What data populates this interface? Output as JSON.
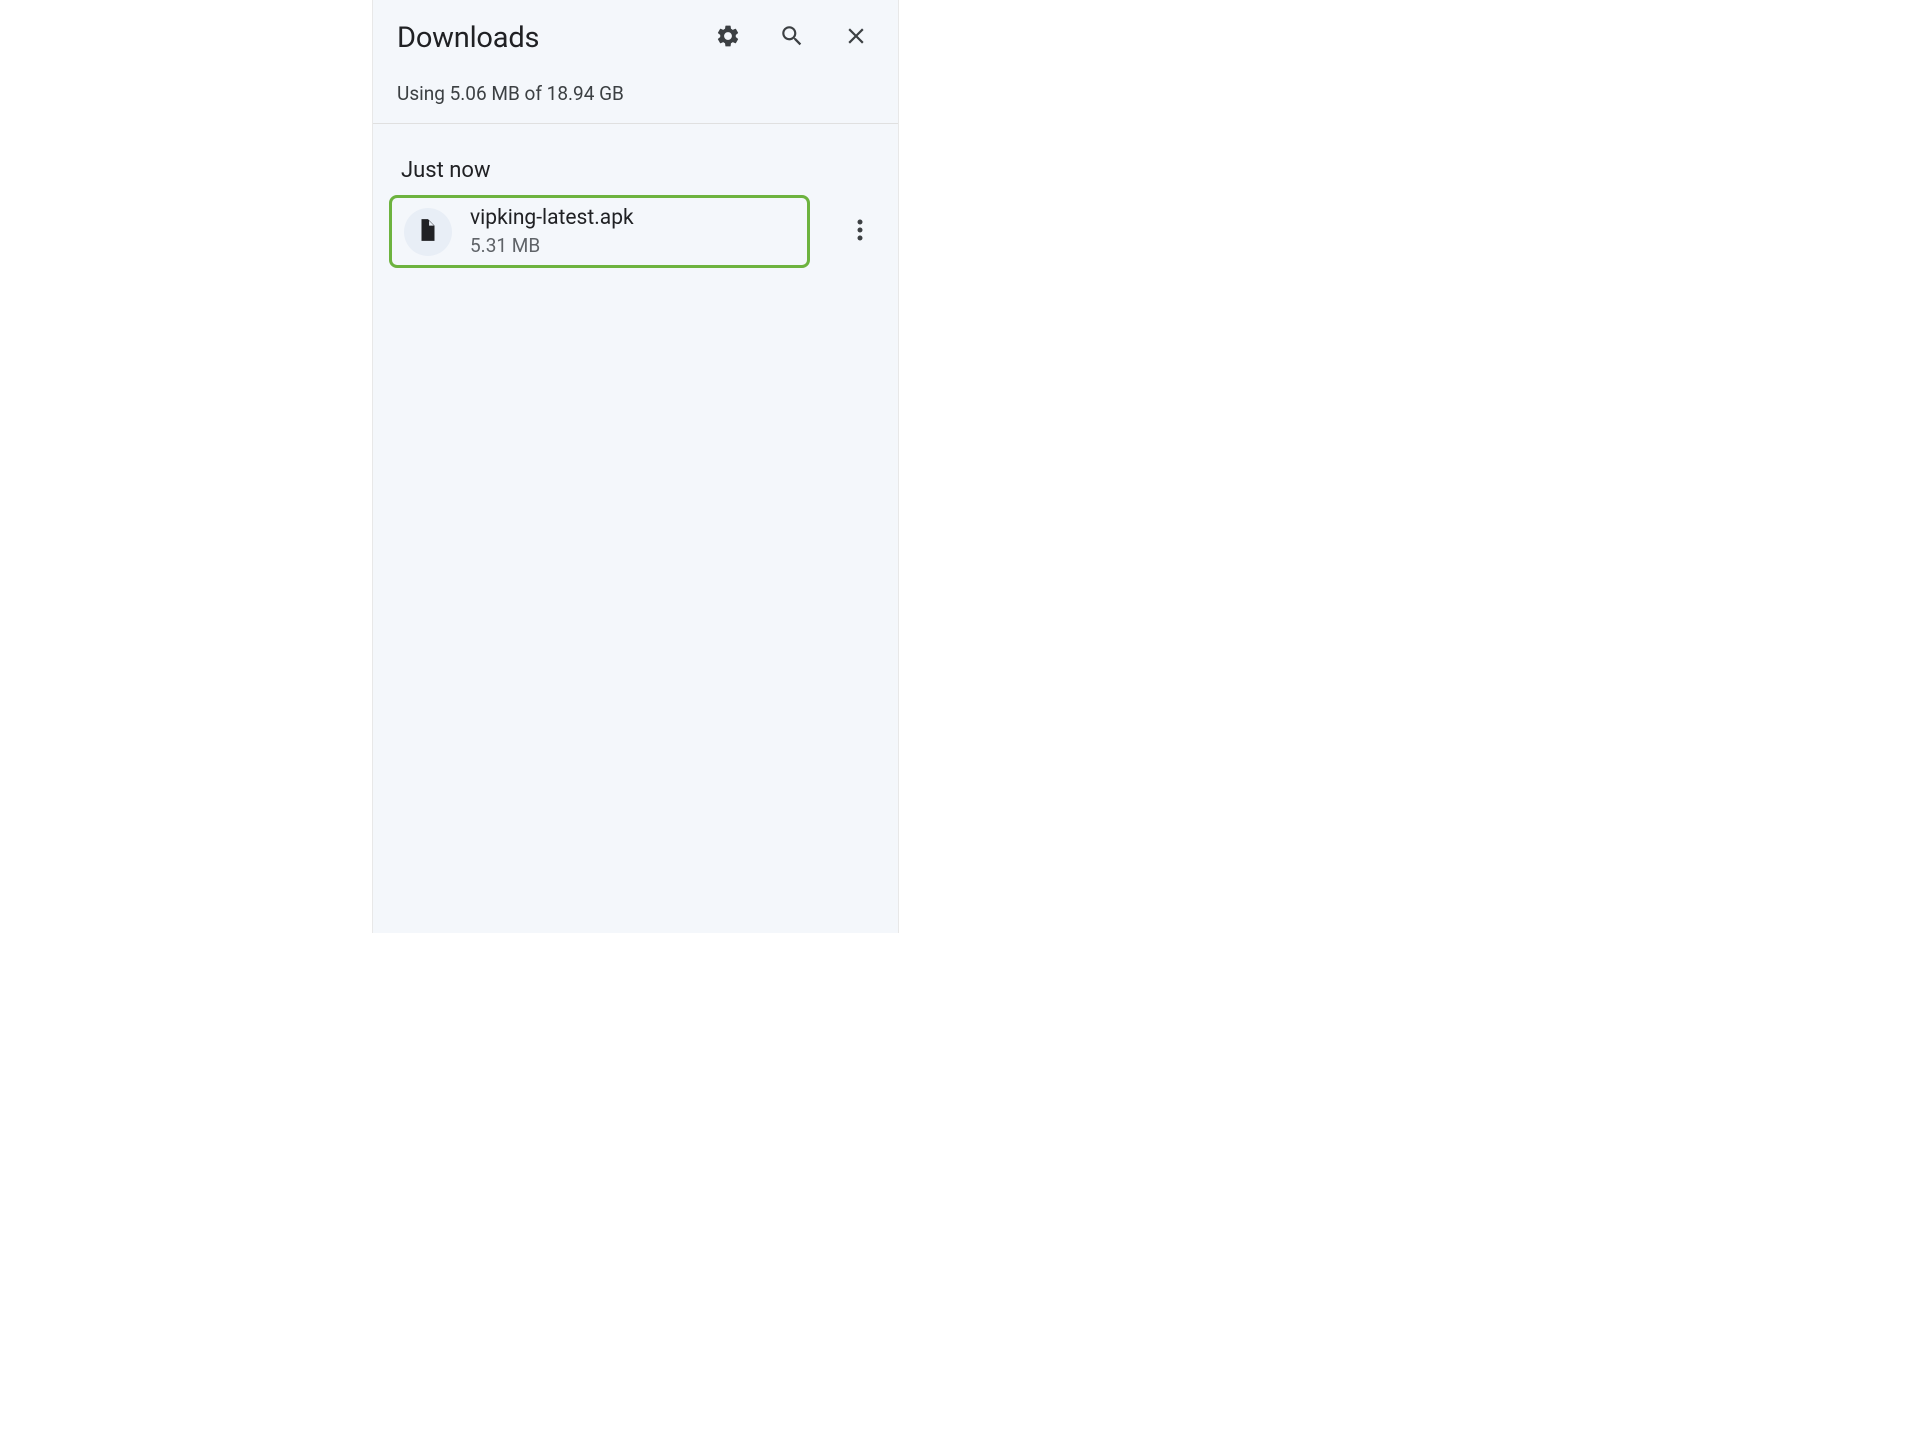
{
  "header": {
    "title": "Downloads"
  },
  "storage": {
    "text": "Using 5.06 MB of 18.94 GB"
  },
  "sections": [
    {
      "label": "Just now",
      "files": [
        {
          "name": "vipking-latest.apk",
          "size": "5.31 MB"
        }
      ]
    }
  ]
}
